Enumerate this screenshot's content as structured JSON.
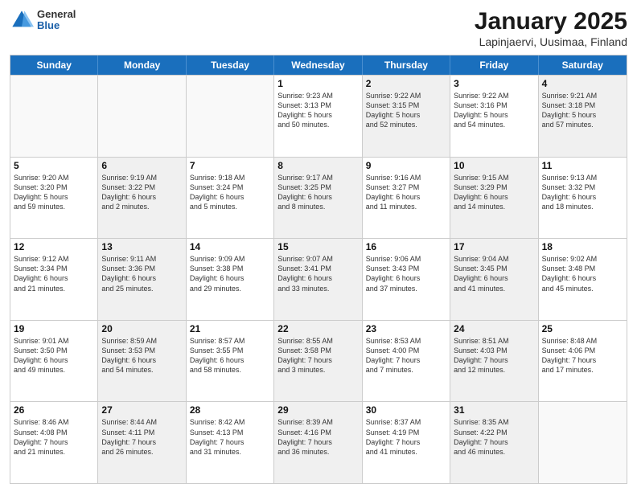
{
  "header": {
    "logo": {
      "general": "General",
      "blue": "Blue"
    },
    "title": "January 2025",
    "location": "Lapinjaervi, Uusimaa, Finland"
  },
  "days_of_week": [
    "Sunday",
    "Monday",
    "Tuesday",
    "Wednesday",
    "Thursday",
    "Friday",
    "Saturday"
  ],
  "weeks": [
    [
      {
        "day": "",
        "info": "",
        "shaded": false,
        "empty": true
      },
      {
        "day": "",
        "info": "",
        "shaded": false,
        "empty": true
      },
      {
        "day": "",
        "info": "",
        "shaded": false,
        "empty": true
      },
      {
        "day": "1",
        "info": "Sunrise: 9:23 AM\nSunset: 3:13 PM\nDaylight: 5 hours\nand 50 minutes.",
        "shaded": false,
        "empty": false
      },
      {
        "day": "2",
        "info": "Sunrise: 9:22 AM\nSunset: 3:15 PM\nDaylight: 5 hours\nand 52 minutes.",
        "shaded": true,
        "empty": false
      },
      {
        "day": "3",
        "info": "Sunrise: 9:22 AM\nSunset: 3:16 PM\nDaylight: 5 hours\nand 54 minutes.",
        "shaded": false,
        "empty": false
      },
      {
        "day": "4",
        "info": "Sunrise: 9:21 AM\nSunset: 3:18 PM\nDaylight: 5 hours\nand 57 minutes.",
        "shaded": true,
        "empty": false
      }
    ],
    [
      {
        "day": "5",
        "info": "Sunrise: 9:20 AM\nSunset: 3:20 PM\nDaylight: 5 hours\nand 59 minutes.",
        "shaded": false,
        "empty": false
      },
      {
        "day": "6",
        "info": "Sunrise: 9:19 AM\nSunset: 3:22 PM\nDaylight: 6 hours\nand 2 minutes.",
        "shaded": true,
        "empty": false
      },
      {
        "day": "7",
        "info": "Sunrise: 9:18 AM\nSunset: 3:24 PM\nDaylight: 6 hours\nand 5 minutes.",
        "shaded": false,
        "empty": false
      },
      {
        "day": "8",
        "info": "Sunrise: 9:17 AM\nSunset: 3:25 PM\nDaylight: 6 hours\nand 8 minutes.",
        "shaded": true,
        "empty": false
      },
      {
        "day": "9",
        "info": "Sunrise: 9:16 AM\nSunset: 3:27 PM\nDaylight: 6 hours\nand 11 minutes.",
        "shaded": false,
        "empty": false
      },
      {
        "day": "10",
        "info": "Sunrise: 9:15 AM\nSunset: 3:29 PM\nDaylight: 6 hours\nand 14 minutes.",
        "shaded": true,
        "empty": false
      },
      {
        "day": "11",
        "info": "Sunrise: 9:13 AM\nSunset: 3:32 PM\nDaylight: 6 hours\nand 18 minutes.",
        "shaded": false,
        "empty": false
      }
    ],
    [
      {
        "day": "12",
        "info": "Sunrise: 9:12 AM\nSunset: 3:34 PM\nDaylight: 6 hours\nand 21 minutes.",
        "shaded": false,
        "empty": false
      },
      {
        "day": "13",
        "info": "Sunrise: 9:11 AM\nSunset: 3:36 PM\nDaylight: 6 hours\nand 25 minutes.",
        "shaded": true,
        "empty": false
      },
      {
        "day": "14",
        "info": "Sunrise: 9:09 AM\nSunset: 3:38 PM\nDaylight: 6 hours\nand 29 minutes.",
        "shaded": false,
        "empty": false
      },
      {
        "day": "15",
        "info": "Sunrise: 9:07 AM\nSunset: 3:41 PM\nDaylight: 6 hours\nand 33 minutes.",
        "shaded": true,
        "empty": false
      },
      {
        "day": "16",
        "info": "Sunrise: 9:06 AM\nSunset: 3:43 PM\nDaylight: 6 hours\nand 37 minutes.",
        "shaded": false,
        "empty": false
      },
      {
        "day": "17",
        "info": "Sunrise: 9:04 AM\nSunset: 3:45 PM\nDaylight: 6 hours\nand 41 minutes.",
        "shaded": true,
        "empty": false
      },
      {
        "day": "18",
        "info": "Sunrise: 9:02 AM\nSunset: 3:48 PM\nDaylight: 6 hours\nand 45 minutes.",
        "shaded": false,
        "empty": false
      }
    ],
    [
      {
        "day": "19",
        "info": "Sunrise: 9:01 AM\nSunset: 3:50 PM\nDaylight: 6 hours\nand 49 minutes.",
        "shaded": false,
        "empty": false
      },
      {
        "day": "20",
        "info": "Sunrise: 8:59 AM\nSunset: 3:53 PM\nDaylight: 6 hours\nand 54 minutes.",
        "shaded": true,
        "empty": false
      },
      {
        "day": "21",
        "info": "Sunrise: 8:57 AM\nSunset: 3:55 PM\nDaylight: 6 hours\nand 58 minutes.",
        "shaded": false,
        "empty": false
      },
      {
        "day": "22",
        "info": "Sunrise: 8:55 AM\nSunset: 3:58 PM\nDaylight: 7 hours\nand 3 minutes.",
        "shaded": true,
        "empty": false
      },
      {
        "day": "23",
        "info": "Sunrise: 8:53 AM\nSunset: 4:00 PM\nDaylight: 7 hours\nand 7 minutes.",
        "shaded": false,
        "empty": false
      },
      {
        "day": "24",
        "info": "Sunrise: 8:51 AM\nSunset: 4:03 PM\nDaylight: 7 hours\nand 12 minutes.",
        "shaded": true,
        "empty": false
      },
      {
        "day": "25",
        "info": "Sunrise: 8:48 AM\nSunset: 4:06 PM\nDaylight: 7 hours\nand 17 minutes.",
        "shaded": false,
        "empty": false
      }
    ],
    [
      {
        "day": "26",
        "info": "Sunrise: 8:46 AM\nSunset: 4:08 PM\nDaylight: 7 hours\nand 21 minutes.",
        "shaded": false,
        "empty": false
      },
      {
        "day": "27",
        "info": "Sunrise: 8:44 AM\nSunset: 4:11 PM\nDaylight: 7 hours\nand 26 minutes.",
        "shaded": true,
        "empty": false
      },
      {
        "day": "28",
        "info": "Sunrise: 8:42 AM\nSunset: 4:13 PM\nDaylight: 7 hours\nand 31 minutes.",
        "shaded": false,
        "empty": false
      },
      {
        "day": "29",
        "info": "Sunrise: 8:39 AM\nSunset: 4:16 PM\nDaylight: 7 hours\nand 36 minutes.",
        "shaded": true,
        "empty": false
      },
      {
        "day": "30",
        "info": "Sunrise: 8:37 AM\nSunset: 4:19 PM\nDaylight: 7 hours\nand 41 minutes.",
        "shaded": false,
        "empty": false
      },
      {
        "day": "31",
        "info": "Sunrise: 8:35 AM\nSunset: 4:22 PM\nDaylight: 7 hours\nand 46 minutes.",
        "shaded": true,
        "empty": false
      },
      {
        "day": "",
        "info": "",
        "shaded": false,
        "empty": true
      }
    ]
  ]
}
